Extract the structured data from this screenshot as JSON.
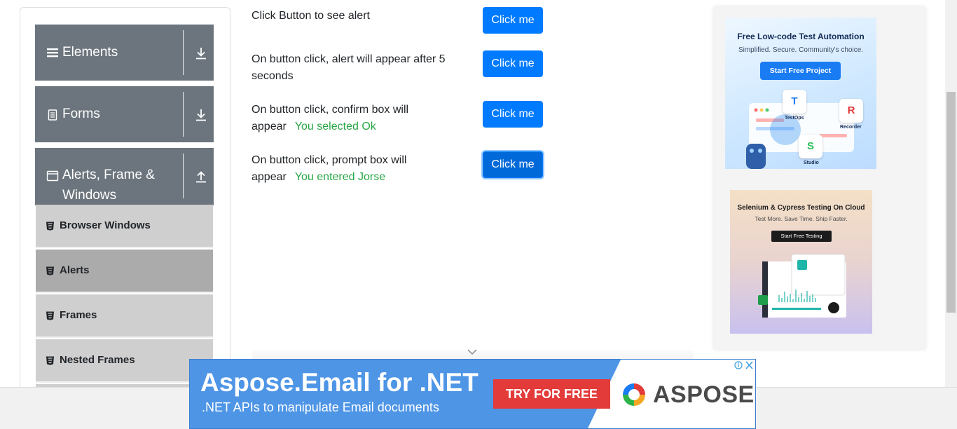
{
  "sidebar": {
    "groups": [
      {
        "label": "Elements",
        "icon": "hamburger-icon",
        "arrow": "download-arrow-icon"
      },
      {
        "label": "Forms",
        "icon": "document-icon",
        "arrow": "download-arrow-icon"
      },
      {
        "label": "Alerts, Frame & Windows",
        "label_line1": "Alerts, Frame &",
        "label_line2": "Windows",
        "icon": "window-icon",
        "arrow": "upload-arrow-icon"
      }
    ],
    "items": [
      {
        "label": "Browser Windows",
        "icon": "html5-icon"
      },
      {
        "label": "Alerts",
        "icon": "html5-icon",
        "active": true
      },
      {
        "label": "Frames",
        "icon": "html5-icon"
      },
      {
        "label": "Nested Frames",
        "icon": "html5-icon"
      }
    ]
  },
  "main": {
    "rows": [
      {
        "text": "Click Button to see alert",
        "button": "Click me"
      },
      {
        "text": "On button click, alert will appear after 5 seconds",
        "line1": "On button click, alert will appear after 5",
        "line2": "seconds",
        "button": "Click me"
      },
      {
        "line1": "On button click, confirm box will",
        "line2": "appear",
        "result": "You selected Ok",
        "button": "Click me"
      },
      {
        "line1": "On button click, prompt box will",
        "line2": "appear",
        "result": "You entered Jorse",
        "button": "Click me"
      }
    ]
  },
  "ads": {
    "katalon": {
      "title": "Free Low-code Test Automation",
      "subtitle": "Simplified. Secure. Community's choice.",
      "cta": "Start Free Project",
      "tiles": [
        "TestOps",
        "Recorder",
        "Studio"
      ]
    },
    "lambdatest": {
      "title": "Selenium & Cypress Testing On Cloud",
      "subtitle": "Test More. Save Time. Ship Faster.",
      "cta": "Start Free Testing"
    },
    "aspose": {
      "title": "Aspose.Email for .NET",
      "subtitle": ".NET APIs to manipulate Email documents",
      "cta": "TRY FOR FREE",
      "brand": "ASPOSE"
    }
  },
  "colors": {
    "sidebar_group": "#6c757d",
    "sidebar_item": "#cfcfcf",
    "sidebar_item_active": "#ababab",
    "primary_button": "#007bff",
    "success_text": "#28a745"
  }
}
